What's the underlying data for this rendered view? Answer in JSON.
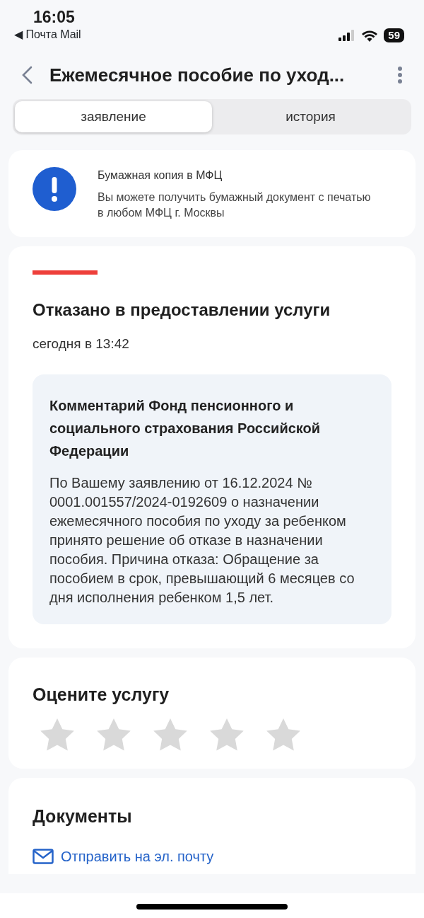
{
  "status_bar": {
    "time": "16:05",
    "back_app": "◀ Почта Mail",
    "battery": "59"
  },
  "header": {
    "title": "Ежемесячное пособие по уход..."
  },
  "tabs": [
    {
      "label": "заявление",
      "selected": true
    },
    {
      "label": "история",
      "selected": false
    }
  ],
  "notice": {
    "title": "Бумажная копия в МФЦ",
    "text": "Вы можете получить бумажный документ с печатью в любом МФЦ г. Москвы"
  },
  "status_card": {
    "title": "Отказано в предоставлении услуги",
    "time": "сегодня в 13:42",
    "comment": {
      "title": "Комментарий Фонд пенсионного и социального страхования Российской Федерации",
      "text": "По Вашему заявлению от 16.12.2024 № 0001.001557/2024-0192609 о назначении ежемесячного пособия по уходу за ребенком принято решение об отказе в назначении пособия. Причина отказа: Обращение за пособием в срок, превышающий 6 месяцев со дня исполнения ребенком 1,5 лет."
    }
  },
  "rating": {
    "title": "Оцените услугу",
    "stars": 0
  },
  "documents": {
    "title": "Документы",
    "link": "Отправить на эл. почту"
  }
}
